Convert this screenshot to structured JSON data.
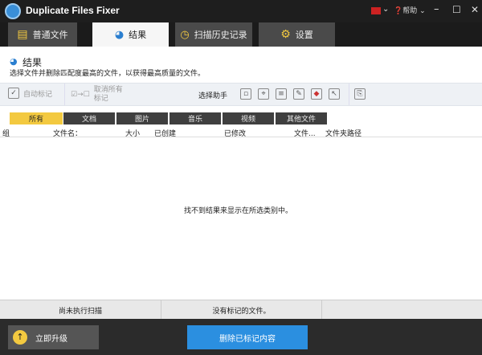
{
  "app": {
    "title": "Duplicate Files Fixer",
    "help": "帮助"
  },
  "tabs": [
    {
      "label": "普通文件"
    },
    {
      "label": "结果"
    },
    {
      "label": "扫描历史记录"
    },
    {
      "label": "设置"
    }
  ],
  "page": {
    "title": "结果",
    "description": "选择文件并删除匹配度最高的文件，以获得最高质量的文件。"
  },
  "toolbar": {
    "auto_mark": "自动标记",
    "unmark_all": "取消所有标记",
    "selection_assistant": "选择助手"
  },
  "categories": [
    "所有",
    "文档",
    "图片",
    "音乐",
    "视频",
    "其他文件"
  ],
  "columns": [
    "组",
    "文件名：",
    "大小",
    "已创建",
    "已修改",
    "文件...",
    "文件夹路径"
  ],
  "empty_message": "找不到结果来显示在所选类别中。",
  "status": {
    "scan": "尚未执行扫描",
    "marked": "没有标记的文件。"
  },
  "bottom": {
    "upgrade": "立即升级",
    "delete": "删除已标记内容"
  },
  "colors": {
    "accent": "#2b8fe0",
    "category_active": "#f3c940"
  }
}
